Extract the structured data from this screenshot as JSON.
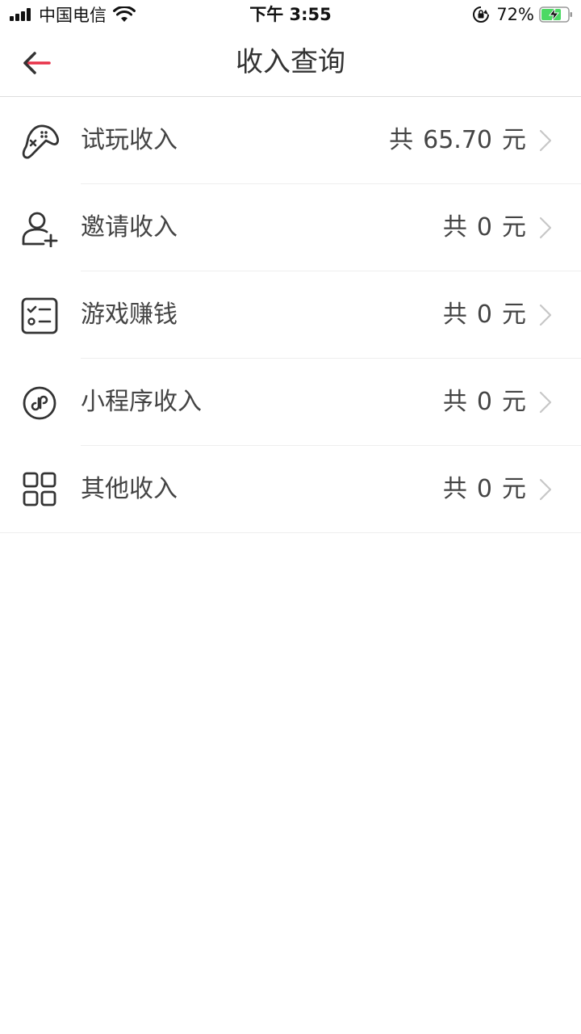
{
  "status_bar": {
    "carrier": "中国电信",
    "time": "下午 3:55",
    "battery_percent": "72%",
    "signal_bars": 4,
    "icons": [
      "signal-icon",
      "wifi-icon",
      "orientation-lock-icon",
      "battery-charging-icon"
    ]
  },
  "nav": {
    "title": "收入查询",
    "back_icon": "back-arrow-icon",
    "accent_color": "#e8334a"
  },
  "income_items": [
    {
      "label": "试玩收入",
      "prefix": "共",
      "amount": "65.70",
      "unit": "元",
      "icon": "gamepad-icon"
    },
    {
      "label": "邀请收入",
      "prefix": "共",
      "amount": "0",
      "unit": "元",
      "icon": "add-user-icon"
    },
    {
      "label": "游戏赚钱",
      "prefix": "共",
      "amount": "0",
      "unit": "元",
      "icon": "checklist-icon"
    },
    {
      "label": "小程序收入",
      "prefix": "共",
      "amount": "0",
      "unit": "元",
      "icon": "mini-program-icon"
    },
    {
      "label": "其他收入",
      "prefix": "共",
      "amount": "0",
      "unit": "元",
      "icon": "grid-icon"
    }
  ]
}
